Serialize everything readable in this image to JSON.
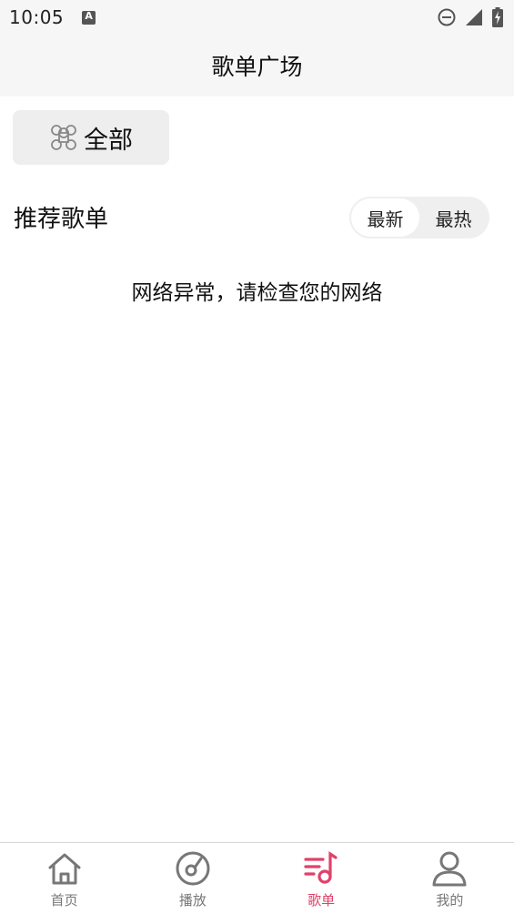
{
  "status_bar": {
    "time": "10:05",
    "a_badge": "A",
    "icons": [
      "do-not-disturb-icon",
      "signal-icon",
      "battery-charging-icon"
    ]
  },
  "header": {
    "title": "歌单广场"
  },
  "category": {
    "label": "全部",
    "icon": "command-icon"
  },
  "section": {
    "title": "推荐歌单",
    "sort_options": [
      "最新",
      "最热"
    ],
    "selected_sort": "最新"
  },
  "message": "网络异常，请检查您的网络",
  "bottom_nav": {
    "active_index": 2,
    "active_color": "#e0416b",
    "items": [
      {
        "label": "首页",
        "icon": "home-icon"
      },
      {
        "label": "播放",
        "icon": "disc-icon"
      },
      {
        "label": "歌单",
        "icon": "playlist-icon"
      },
      {
        "label": "我的",
        "icon": "user-icon"
      }
    ]
  }
}
